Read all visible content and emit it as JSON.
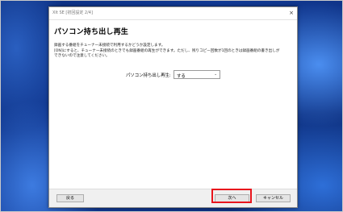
{
  "window": {
    "title": "XIt SE [初回設定 2/4]",
    "close_glyph": "×"
  },
  "page": {
    "title": "パソコン持ち出し再生",
    "description_lines": [
      "録画する番組をチューナー未接続で利用するかどうか設定します。",
      "[ON]にすると、チューナー未接続のときでも録画番組の再生ができます。ただし、残りコピー回数が1回のときは録画番組の書き出しが",
      "できないので注意してください。"
    ]
  },
  "setting": {
    "label": "パソコン持ち出し再生:",
    "value": "する",
    "arrow_glyph": "⌄"
  },
  "footer": {
    "back_label": "戻る",
    "next_label": "次へ",
    "cancel_label": "キャンセル"
  },
  "colors": {
    "highlight": "#e8141c"
  }
}
